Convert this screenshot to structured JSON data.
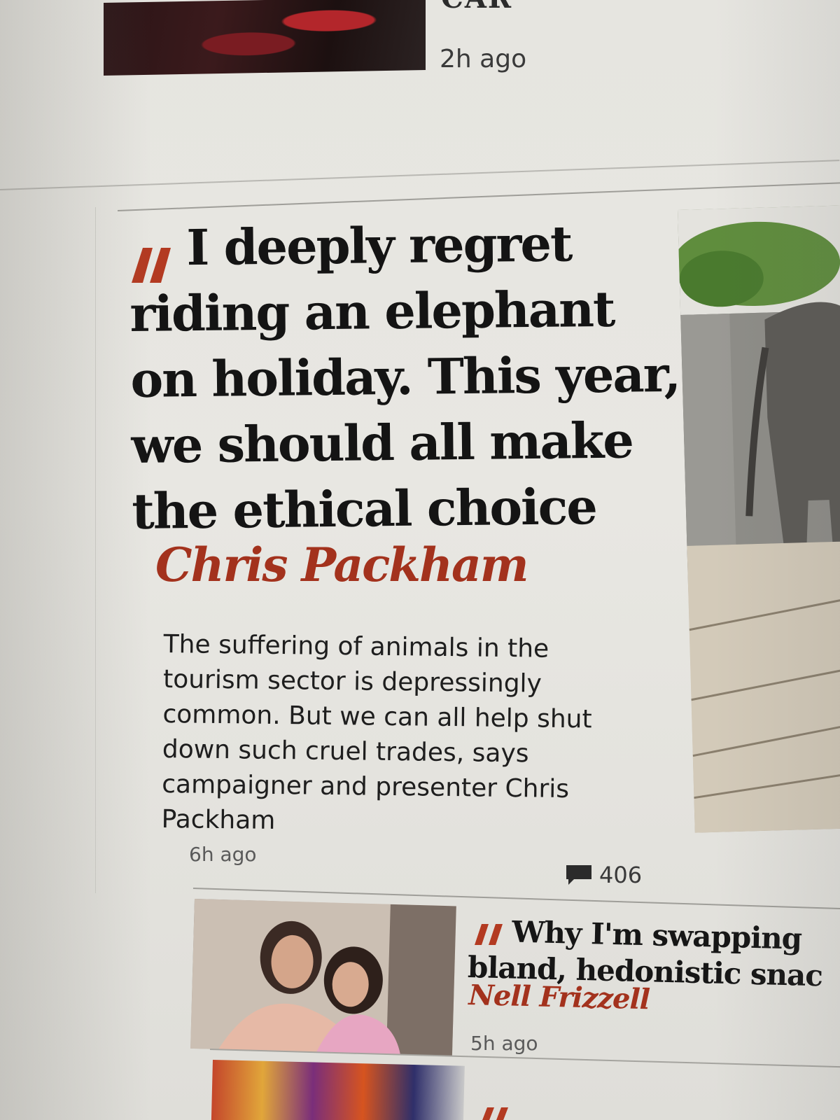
{
  "top_card": {
    "headline_fragment": "CAR",
    "time": "2h ago"
  },
  "main_card": {
    "headline": "I deeply regret riding an elephant on holiday. This year, we should all make the ethical choice",
    "byline": "Chris Packham",
    "standfirst": "The suffering of animals in the tourism sector is depressingly common. But we can all help shut down such cruel trades, says campaigner and presenter Chris Packham",
    "time": "6h ago",
    "comment_count": "406"
  },
  "second_card": {
    "headline": "Why I'm swapping bland, hedonistic snac",
    "headline_line1": "Why I'm swapping",
    "headline_line2": "bland, hedonistic snac",
    "byline": "Nell Frizzell",
    "time": "5h ago"
  },
  "colors": {
    "accent_red": "#a3321d",
    "quote_mark": "#b33a21",
    "headline": "#141414"
  },
  "icons": {
    "quote": "quote-icon",
    "comment": "comment-icon"
  }
}
